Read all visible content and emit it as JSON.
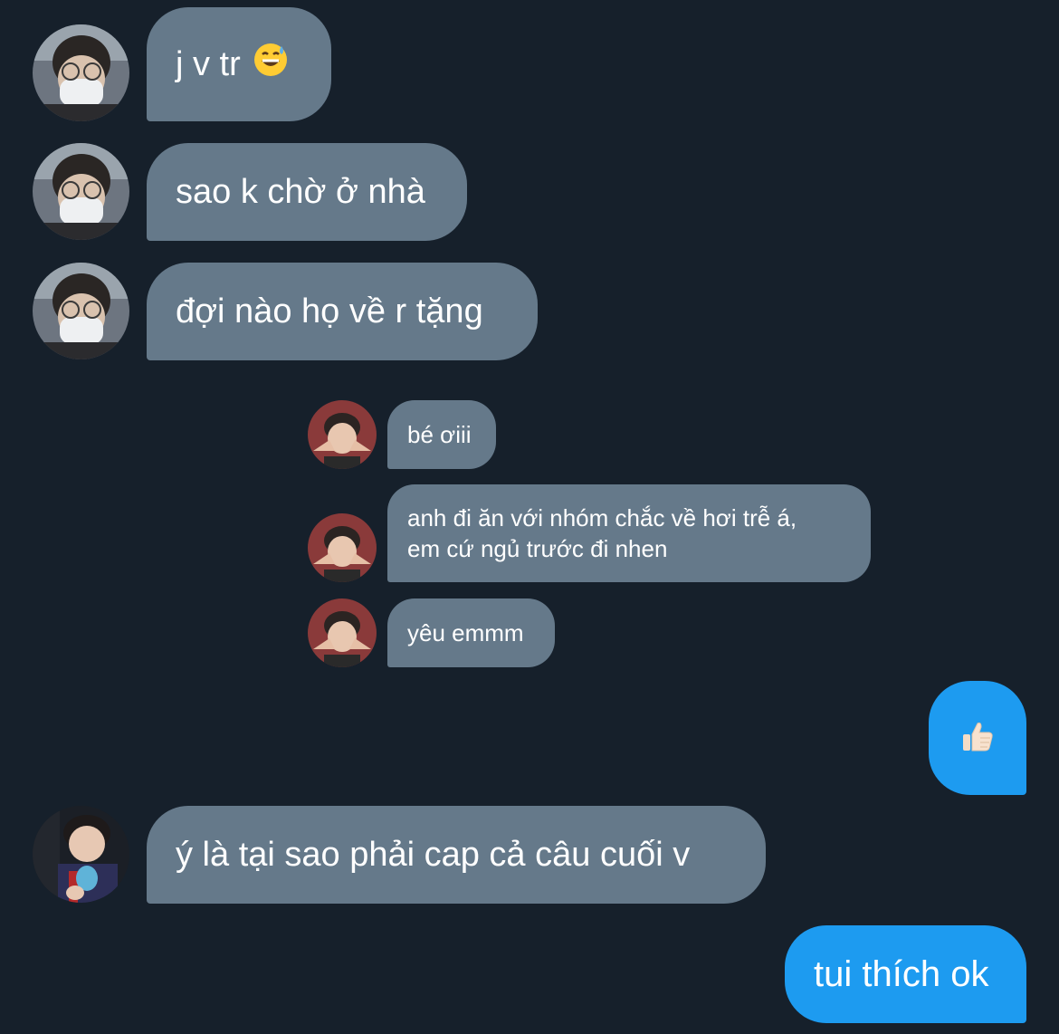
{
  "conversation": {
    "incoming": [
      {
        "text": "j v tr",
        "emoji": "grinning-face-with-sweat-icon"
      },
      {
        "text": "sao k chờ ở nhà"
      },
      {
        "text": "đợi nào họ về r tặng"
      }
    ],
    "quoted": [
      {
        "text": "bé ơiii"
      },
      {
        "lines": [
          "anh đi ăn với nhóm chắc về hơi trễ á,",
          "em cứ ngủ trước đi nhen"
        ]
      },
      {
        "text": "yêu emmm"
      }
    ],
    "outgoing_reaction": {
      "emoji": "thumbs-up-icon"
    },
    "incoming_2": {
      "text": "ý là tại sao phải cap cả câu cuối v"
    },
    "outgoing": {
      "text": "tui thích ok"
    }
  },
  "colors": {
    "background": "#16202b",
    "incoming_bubble": "#65798a",
    "outgoing_bubble": "#1d9bf0"
  }
}
